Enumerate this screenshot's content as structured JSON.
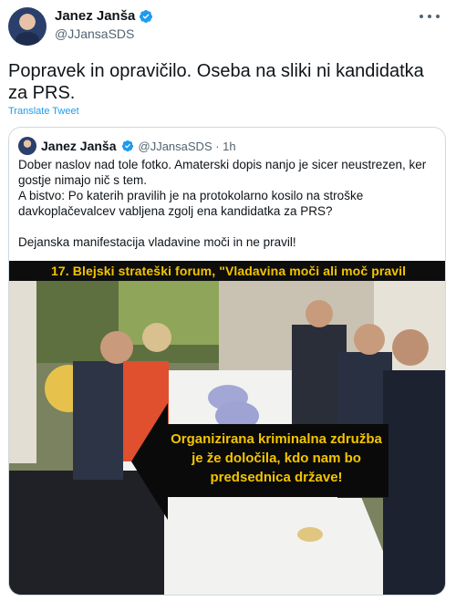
{
  "tweet": {
    "author_name": "Janez Janša",
    "author_handle": "@JJansaSDS",
    "text": "Popravek in opravičilo. Oseba na sliki ni kandidatka za PRS.",
    "translate_label": "Translate Tweet"
  },
  "quoted_tweet": {
    "author_name": "Janez Janša",
    "author_meta": "@JJansaSDS · 1h",
    "text_lines": [
      "Dober naslov nad tole fotko. Amaterski dopis nanjo je sicer neustrezen, ker gostje nimajo nič s tem.",
      "A bistvo: Po katerih pravilih je na protokolarno kosilo na stroške davkoplačevalcev vabljena zgolj ena kandidatka za PRS?",
      "Dejanska manifestacija vladavine moči in ne pravil!"
    ],
    "photo": {
      "banner_text": "17. Blejski strateški forum, \"Vladavina moči ali moč pravil",
      "overlay_text": "Organizirana kriminalna združba je že določila, kdo nam bo predsednica države!"
    }
  },
  "colors": {
    "accent": "#1d9bf0",
    "secondary_text": "#536471",
    "border": "#cfd9de",
    "overlay_yellow": "#f3c400"
  },
  "icons": {
    "verified": "verified-badge-icon",
    "more": "more-options-icon"
  }
}
